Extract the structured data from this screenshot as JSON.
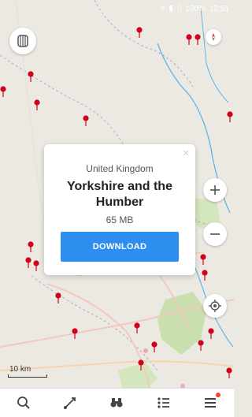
{
  "status_bar": {
    "time": "12:51",
    "battery": "100%",
    "icons": [
      "location-icon",
      "signal-icon",
      "battery-icon"
    ]
  },
  "map": {
    "scale_label": "10 km",
    "icons": [
      "layers-icon",
      "compass-icon",
      "zoom-in-icon",
      "zoom-out-icon",
      "my-location-icon"
    ]
  },
  "download_card": {
    "region": "United Kingdom",
    "title": "Yorkshire and the Humber",
    "size": "65 MB",
    "download_label": "DOWNLOAD",
    "close_icon": "close-icon"
  },
  "bottom_bar": {
    "items": [
      {
        "name": "search",
        "icon": "search-icon"
      },
      {
        "name": "route",
        "icon": "route-icon"
      },
      {
        "name": "discover",
        "icon": "binoculars-icon"
      },
      {
        "name": "bookmarks",
        "icon": "bookmarks-list-icon"
      },
      {
        "name": "menu",
        "icon": "menu-icon"
      }
    ]
  },
  "colors": {
    "accent": "#2d8ef0",
    "pin": "#d0021b",
    "river": "#5fb5e8",
    "road": "#f3c8c0",
    "woodland": "#c9dfae"
  }
}
